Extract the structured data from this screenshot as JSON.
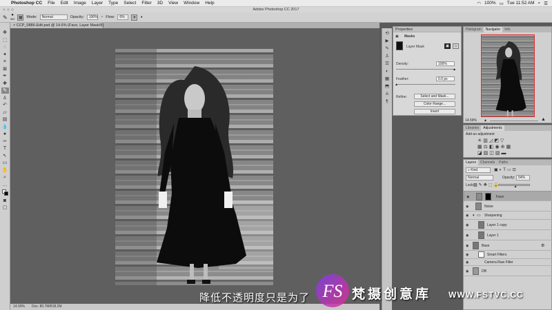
{
  "menubar": {
    "app": "Photoshop CC",
    "items": [
      "File",
      "Edit",
      "Image",
      "Layer",
      "Type",
      "Select",
      "Filter",
      "3D",
      "View",
      "Window",
      "Help"
    ],
    "battery": "100%",
    "clock": "Tue 11:52 AM"
  },
  "titlebar": {
    "title": "Adobe Photoshop CC 2017"
  },
  "options": {
    "brush_size": "500",
    "mode_label": "Mode:",
    "mode_value": "Normal",
    "opacity_label": "Opacity:",
    "opacity_value": "100%",
    "flow_label": "Flow:",
    "flow_value": "6%"
  },
  "document": {
    "tab": "CCP_0886-Edit.psd @ 14.6% (Face, Layer Mask/8) *",
    "zoom": "14.59%",
    "doc_size": "Doc: 80.7M/818.2M"
  },
  "properties": {
    "tab": "Properties",
    "section": "Masks",
    "layer_mask_label": "Layer Mask",
    "density_label": "Density:",
    "density_value": "100%",
    "density_level": 1.0,
    "feather_label": "Feather:",
    "feather_value": "0.0 px",
    "feather_level": 0.0,
    "refine_label": "Refine:",
    "btn_select_mask": "Select and Mask...",
    "btn_color_range": "Color Range...",
    "btn_invert": "Invert"
  },
  "navigator": {
    "tabs": [
      "Histogram",
      "Navigator",
      "Info"
    ],
    "active_tab": "Navigator",
    "zoom": "14.59%"
  },
  "adjustments": {
    "tabs": [
      "Libraries",
      "Adjustments"
    ],
    "active_tab": "Adjustments",
    "hint": "Add an adjustment"
  },
  "layers": {
    "tabs": [
      "Layers",
      "Channels",
      "Paths"
    ],
    "active_tab": "Layers",
    "kind_label": "Kind",
    "blend_mode": "Normal",
    "opacity_label": "Opacity:",
    "opacity_value": "54%",
    "lock_label": "Lock:",
    "rows": [
      {
        "name": "Face"
      },
      {
        "name": "Noise"
      },
      {
        "name": "Sharpening"
      },
      {
        "name": "Layer 1 copy"
      },
      {
        "name": "Layer 1"
      },
      {
        "name": "Base"
      },
      {
        "name": "Smart Filters"
      },
      {
        "name": "Camera Raw Filter"
      },
      {
        "name": "DB"
      }
    ]
  },
  "overlay": {
    "subtitle": "降低不透明度只是为了",
    "logo_text": "FS",
    "brand": "梵摄创意库",
    "site": "WWW.FSTVC.CC"
  },
  "colors": {
    "accent_red": "#e0302f",
    "panel_bg": "#d0d0d0",
    "canvas_bg": "#5f5f5f",
    "logo_gradient": [
      "#7b3fe4",
      "#e0308f"
    ]
  }
}
